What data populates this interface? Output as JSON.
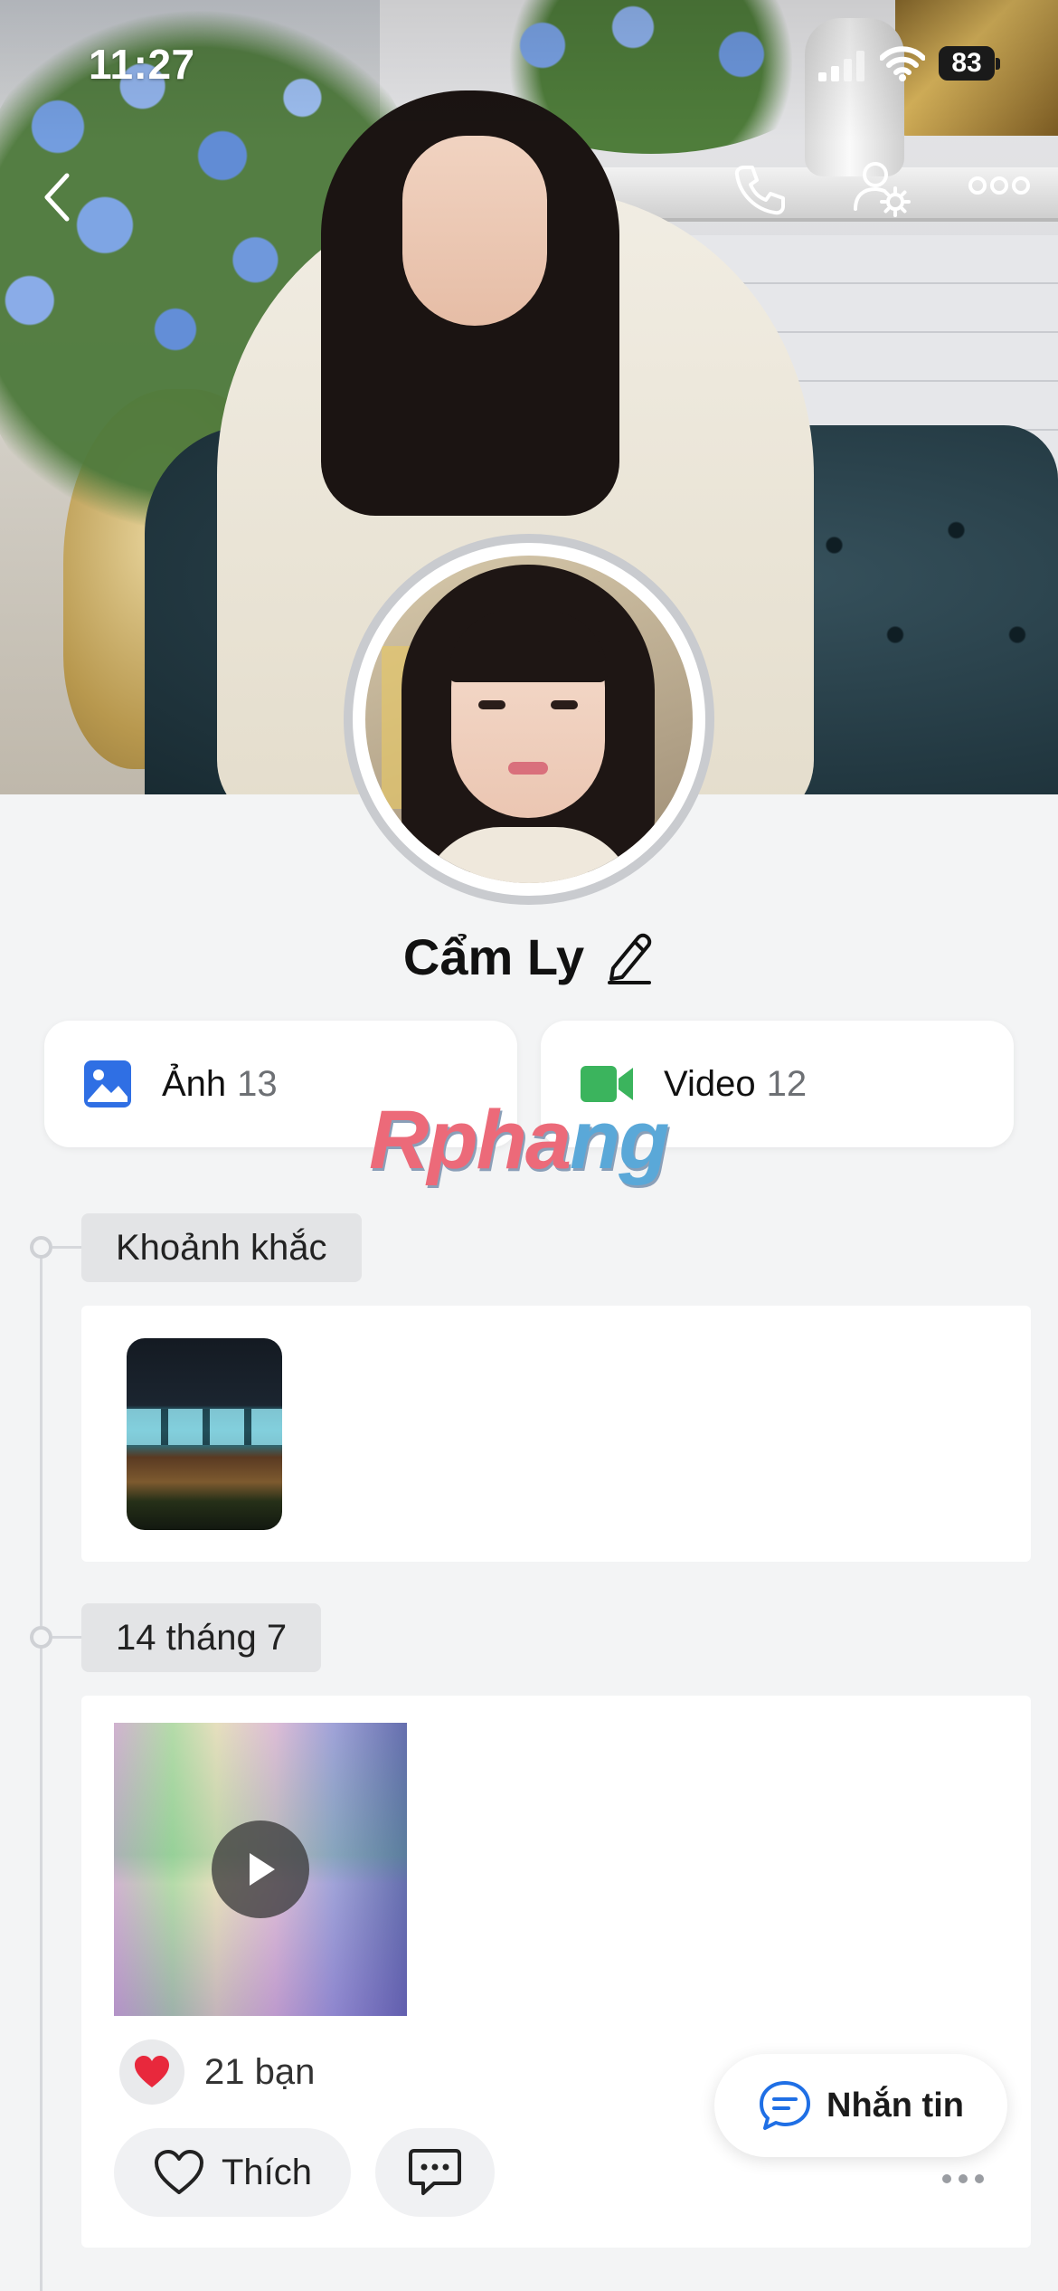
{
  "status_bar": {
    "time": "11:27",
    "battery": "83"
  },
  "profile": {
    "name": "Cẩm Ly"
  },
  "media": {
    "photos": {
      "label": "Ảnh",
      "count": "13",
      "icon": "image-icon",
      "color": "#2f6fe4"
    },
    "videos": {
      "label": "Video",
      "count": "12",
      "icon": "video-camera-icon",
      "color": "#3bb45d"
    }
  },
  "watermark": {
    "part1": "Rpha",
    "part2": "ng"
  },
  "timeline": {
    "moments": {
      "label": "Khoảnh khắc"
    },
    "post": {
      "date": "14 tháng 7",
      "reactions": "21 bạn",
      "like_label": "Thích"
    }
  },
  "floating": {
    "message_label": "Nhắn tin"
  },
  "colors": {
    "accent": "#1f6fe5",
    "background": "#f3f4f5",
    "heart": "#e8283c"
  }
}
